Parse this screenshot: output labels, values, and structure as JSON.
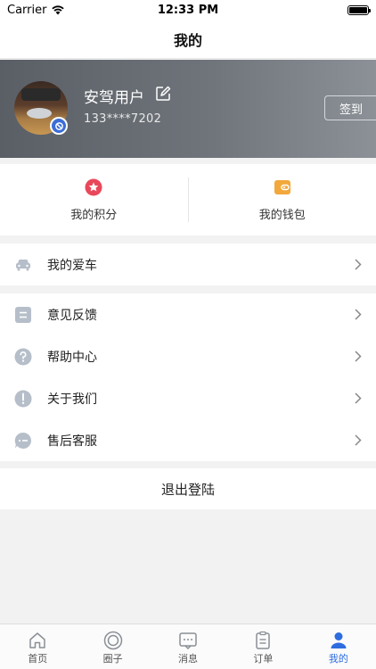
{
  "status_bar": {
    "carrier": "Carrier",
    "time": "12:33 PM"
  },
  "nav": {
    "title": "我的"
  },
  "profile": {
    "name": "安驾用户",
    "phone": "133****7202",
    "signin_label": "签到"
  },
  "stats": [
    {
      "label": "我的积分",
      "icon": "star-badge-icon",
      "color": "#e9485a"
    },
    {
      "label": "我的钱包",
      "icon": "wallet-icon",
      "color": "#f2a83b"
    }
  ],
  "menu": {
    "car": {
      "label": "我的爱车",
      "icon": "car-icon"
    },
    "items": [
      {
        "label": "意见反馈",
        "icon": "feedback-icon"
      },
      {
        "label": "帮助中心",
        "icon": "help-icon"
      },
      {
        "label": "关于我们",
        "icon": "info-icon"
      },
      {
        "label": "售后客服",
        "icon": "chat-icon"
      }
    ]
  },
  "logout_label": "退出登陆",
  "tabs": [
    {
      "label": "首页",
      "icon": "home-icon"
    },
    {
      "label": "圈子",
      "icon": "circle-icon"
    },
    {
      "label": "消息",
      "icon": "message-icon"
    },
    {
      "label": "订单",
      "icon": "order-icon"
    },
    {
      "label": "我的",
      "icon": "profile-icon",
      "active": true
    }
  ],
  "colors": {
    "accent": "#2d6de0",
    "icon_gray": "#b5bec9"
  }
}
